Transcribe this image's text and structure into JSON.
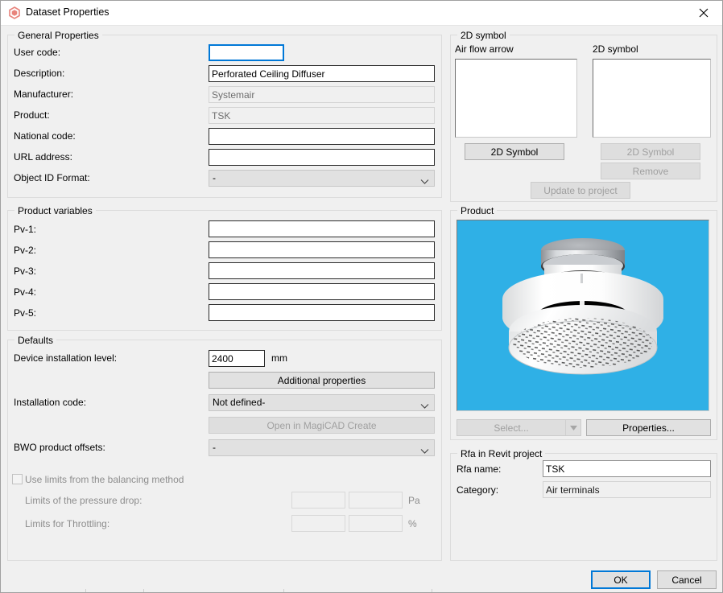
{
  "window": {
    "title": "Dataset Properties",
    "icon": "magicad-hexagon-icon",
    "close_label": "✕",
    "accent": "#0078d7",
    "bg": "#f0f0f0"
  },
  "general_properties": {
    "legend": "General Properties",
    "fields": [
      {
        "label": "User code:",
        "value": "",
        "state": "focused",
        "kind": "text"
      },
      {
        "label": "Description:",
        "value": "Perforated Ceiling Diffuser",
        "state": "normal",
        "kind": "text"
      },
      {
        "label": "Manufacturer:",
        "value": "Systemair",
        "state": "readonly",
        "kind": "text"
      },
      {
        "label": "Product:",
        "value": "TSK",
        "state": "readonly",
        "kind": "text"
      },
      {
        "label": "National code:",
        "value": "",
        "state": "normal",
        "kind": "text"
      },
      {
        "label": "URL address:",
        "value": "",
        "state": "normal",
        "kind": "text"
      },
      {
        "label": "Object ID Format:",
        "value": "-",
        "state": "normal",
        "kind": "combo"
      }
    ]
  },
  "product_variables": {
    "legend": "Product variables",
    "fields": [
      {
        "label": "Pv-1:",
        "value": ""
      },
      {
        "label": "Pv-2:",
        "value": ""
      },
      {
        "label": "Pv-3:",
        "value": ""
      },
      {
        "label": "Pv-4:",
        "value": ""
      },
      {
        "label": "Pv-5:",
        "value": ""
      }
    ]
  },
  "defaults": {
    "legend": "Defaults",
    "device_installation_level_label": "Device installation level:",
    "device_installation_level_value": "2400",
    "device_installation_level_unit": "mm",
    "additional_properties_button": "Additional properties",
    "installation_code_label": "Installation code:",
    "installation_code_value": "Not defined-",
    "open_in_magicad_create_button": "Open in MagiCAD Create",
    "bwo_product_offsets_label": "BWO product offsets:",
    "bwo_product_offsets_value": "-",
    "use_limits_checkbox_label": "Use limits from the balancing method",
    "use_limits_checked": false,
    "limits_pressure_drop_label": "Limits of the pressure drop:",
    "limits_pressure_drop_min": "",
    "limits_pressure_drop_max": "",
    "limits_pressure_drop_unit": "Pa",
    "limits_throttling_label": "Limits for Throttling:",
    "limits_throttling_min": "",
    "limits_throttling_max": "",
    "limits_throttling_unit": "%"
  },
  "symbol_2d": {
    "legend": "2D symbol",
    "air_flow_arrow_label": "Air flow arrow",
    "symbol_label": "2D symbol",
    "air_flow_button": "2D Symbol",
    "symbol_button": "2D Symbol",
    "remove_button": "Remove",
    "update_to_project_button": "Update to project"
  },
  "product": {
    "legend": "Product",
    "image_bg": "#2fb0e6",
    "image_alt": "perforated-ceiling-diffuser-render",
    "select_button": "Select...",
    "properties_button": "Properties..."
  },
  "rfa": {
    "legend": "Rfa in Revit project",
    "name_label": "Rfa name:",
    "name_value": "TSK",
    "category_label": "Category:",
    "category_value": "Air terminals"
  },
  "footer": {
    "ok_button": "OK",
    "cancel_button": "Cancel"
  }
}
